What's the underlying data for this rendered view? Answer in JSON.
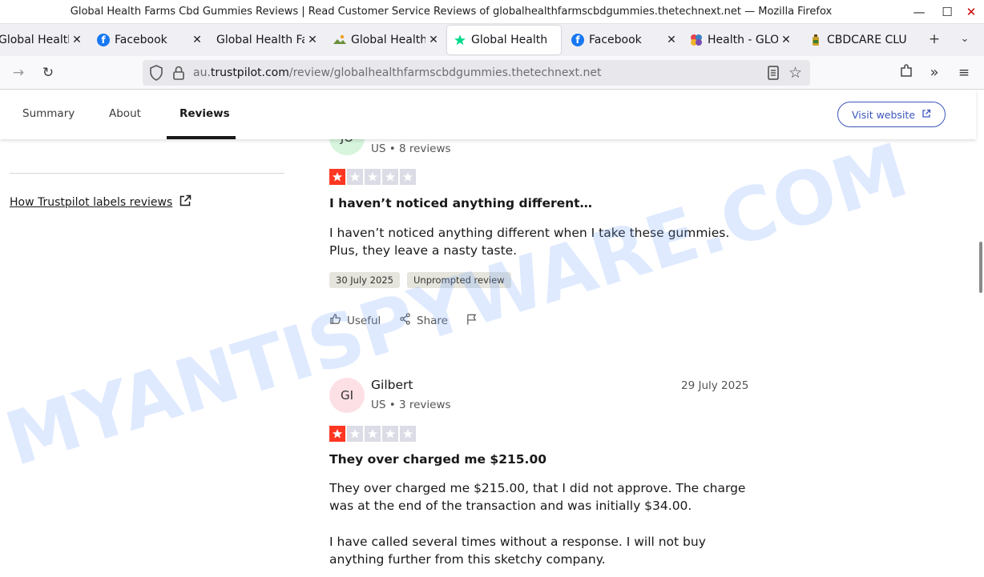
{
  "window": {
    "title": "Global Health Farms Cbd Gummies Reviews | Read Customer Service Reviews of globalhealthfarmscbdgummies.thetechnext.net — Mozilla Firefox"
  },
  "tabs": [
    {
      "label": "Global Health",
      "icon": "globe-icon"
    },
    {
      "label": "Facebook",
      "icon": "facebook-icon"
    },
    {
      "label": "Global Health Far",
      "icon": "none"
    },
    {
      "label": "Global Health",
      "icon": "landscape-icon"
    },
    {
      "label": "Global Health",
      "icon": "trustpilot-star-icon"
    },
    {
      "label": "Facebook",
      "icon": "facebook-icon"
    },
    {
      "label": "Health - GLOB",
      "icon": "colorful-logo-icon"
    },
    {
      "label": "CBDCARE CLU",
      "icon": "bottle-icon"
    }
  ],
  "url": {
    "prefix": "au.",
    "domain": "trustpilot.com",
    "path": "/review/globalhealthfarmscbdgummies.thetechnext.net"
  },
  "subnav": {
    "items": [
      "Summary",
      "About",
      "Reviews"
    ],
    "visit_label": "Visit website"
  },
  "sidebar": {
    "how_link": "How Trustpilot labels reviews"
  },
  "reviews": [
    {
      "initials": "JO",
      "name": "",
      "meta": "US • 8 reviews",
      "rating": 1,
      "title": "I haven’t noticed anything different…",
      "body": "I haven’t noticed anything different when I take these gummies. Plus, they leave a nasty taste.",
      "date_tag": "30 July 2025",
      "label_tag": "Unprompted review",
      "useful": "Useful",
      "share": "Share"
    },
    {
      "initials": "GI",
      "name": "Gilbert",
      "meta": "US • 3 reviews",
      "date": "29 July 2025",
      "rating": 1,
      "title": "They over charged me $215.00",
      "body1": "They over charged me $215.00, that I did not approve. The charge was at the end of the transaction and was initially $34.00.",
      "body2": "I have called several times without a response. I will not buy anything further from this sketchy company."
    }
  ],
  "watermark": "MYANTISPYWARE.COM",
  "colors": {
    "star_red": "#ff3722",
    "link_blue": "#3c57bc"
  }
}
